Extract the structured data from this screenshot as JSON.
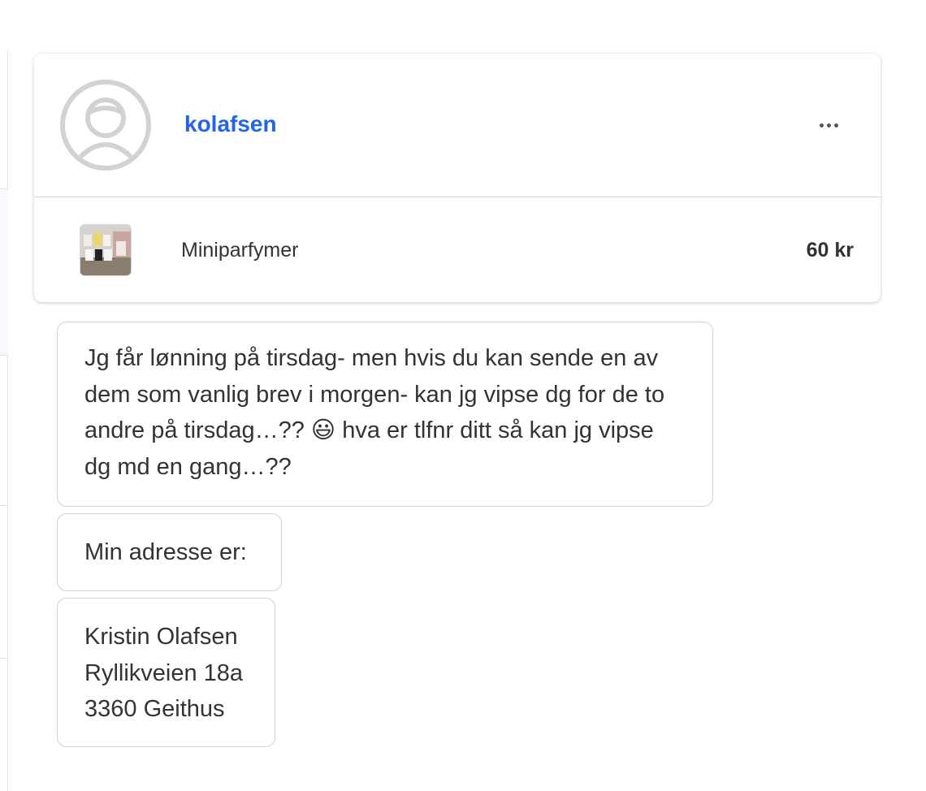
{
  "conversation": {
    "username": "kolafsen",
    "avatar_icon": "user-avatar-placeholder-icon",
    "more_icon": "more-options-icon",
    "link_color": "#2463eb"
  },
  "listing": {
    "title": "Miniparfymer",
    "price": "60 kr"
  },
  "messages": [
    {
      "text": "Jg får lønning på tirsdag- men hvis du kan sende en av dem som vanlig brev i morgen- kan jg vipse dg for de to andre på tirsdag…?? 😃 hva er tlfnr ditt så kan jg vipse dg md en gang…??"
    },
    {
      "text": "Min adresse er:"
    },
    {
      "text": "Kristin Olafsen\nRyllikveien 18a\n3360 Geithus"
    }
  ]
}
